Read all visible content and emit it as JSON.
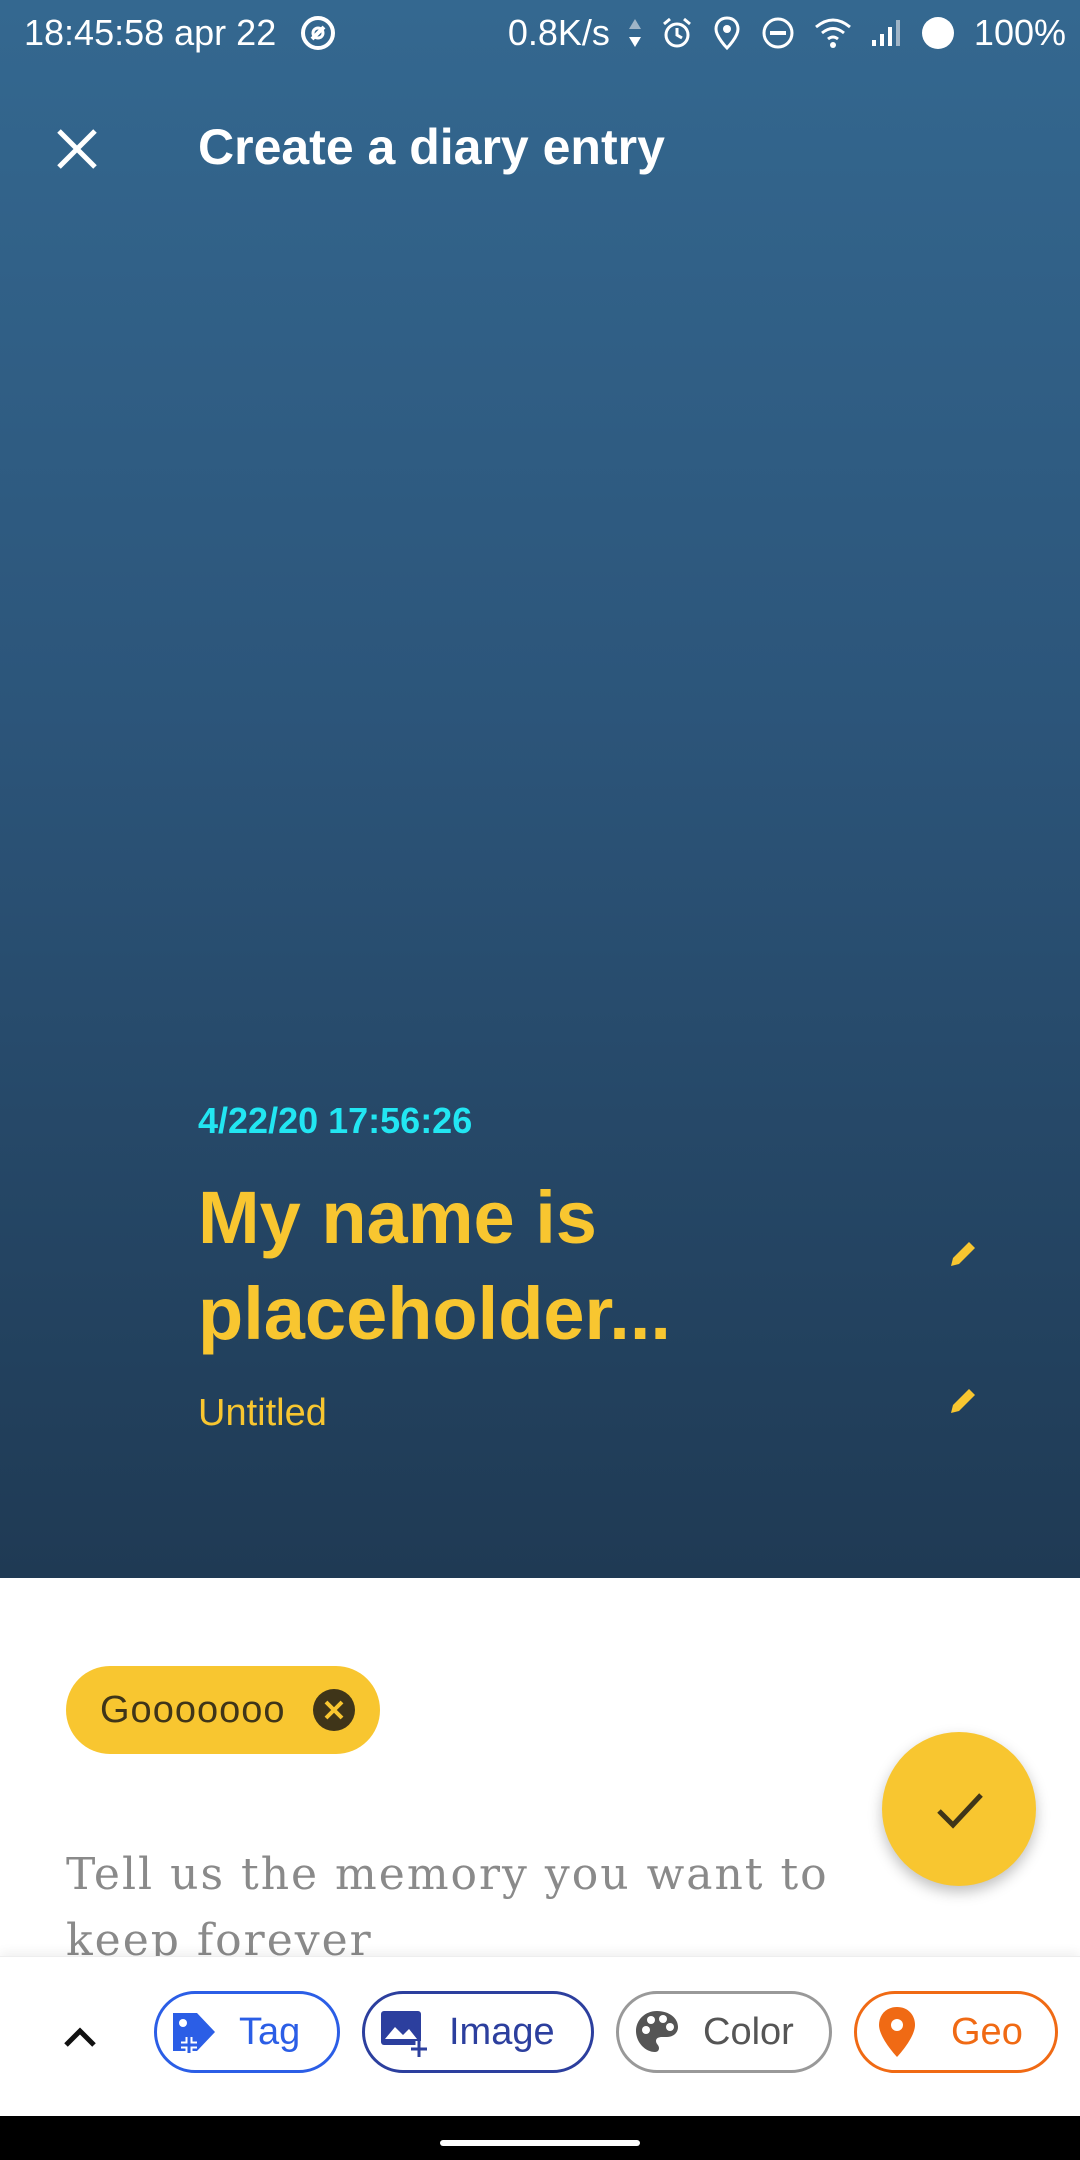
{
  "status_bar": {
    "time_date": "18:45:58 apr 22",
    "net_speed": "0.8K/s",
    "battery": "100%"
  },
  "app_bar": {
    "title": "Create a diary entry"
  },
  "entry": {
    "date": "4/22/20 17:56:26",
    "title": "My name is placeholder...",
    "subtitle": "Untitled"
  },
  "tags": [
    {
      "label": "Gooooooo"
    }
  ],
  "editor": {
    "placeholder": "Tell us the memory you want to keep forever"
  },
  "toolbar": {
    "buttons": [
      {
        "label": "Tag",
        "icon": "tag-add-icon",
        "color": "#2b5ee6"
      },
      {
        "label": "Image",
        "icon": "image-add-icon",
        "color": "#2c3f9e"
      },
      {
        "label": "Color",
        "icon": "palette-icon",
        "color": "#555555"
      },
      {
        "label": "Geo",
        "icon": "location-pin-icon",
        "color": "#f06a14"
      }
    ]
  },
  "colors": {
    "accent": "#f8c630",
    "date": "#22e6f2",
    "header_top": "#346890",
    "header_bottom": "#1f3a54"
  }
}
